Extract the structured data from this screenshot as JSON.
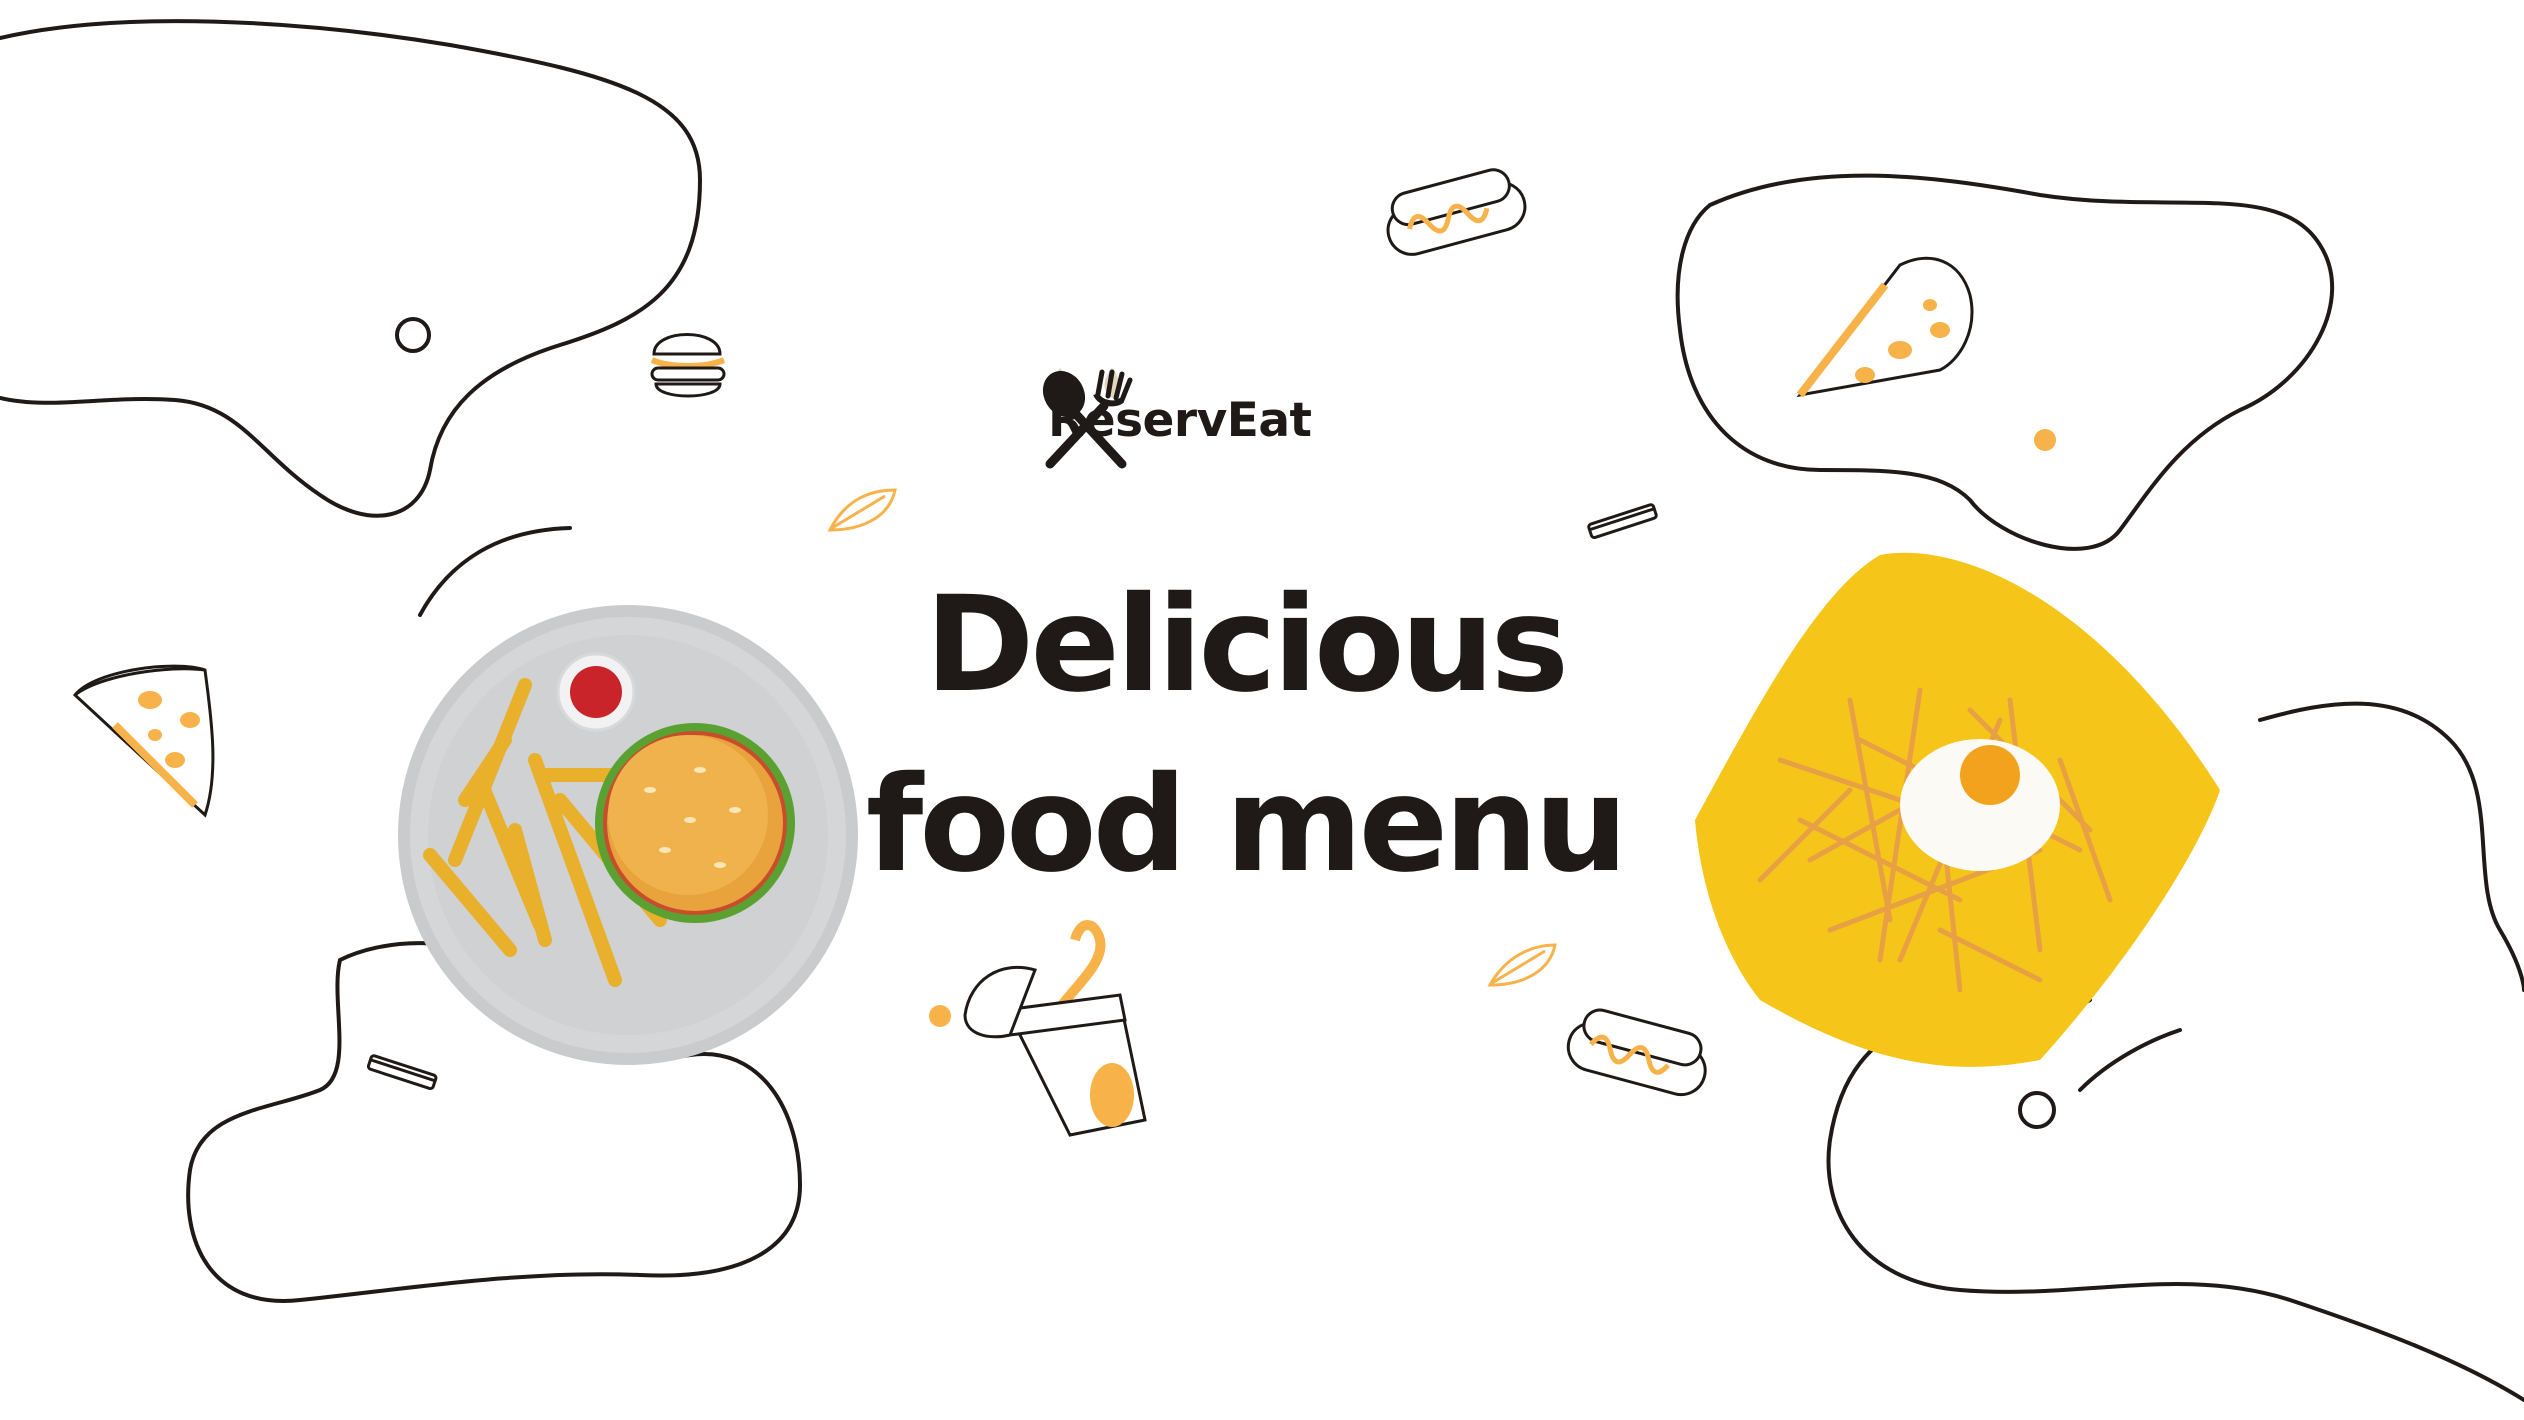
{
  "brand": {
    "name": "ReservEat",
    "logo_icon": "spoon-fork-crossed-icon",
    "logo_color": "#1f1a17",
    "logo_accent": "#b08a3e"
  },
  "hero": {
    "line1": "Delicious",
    "line2": "food menu"
  },
  "colors": {
    "background": "#ffffff",
    "outline": "#1f1a17",
    "accent_orange": "#f7b24a",
    "yellow_plate": "#f6c51a",
    "gray_plate": "#c9cbcc"
  },
  "decorations": [
    "burger-icon",
    "hotdog-icon",
    "pizza-slice-icon",
    "drink-cup-icon",
    "leaf-icon",
    "french-fry-icon"
  ]
}
